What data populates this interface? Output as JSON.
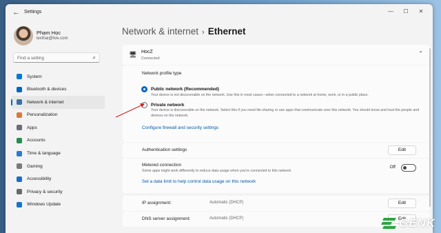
{
  "window": {
    "title": "Settings",
    "back_icon": "back-arrow-icon",
    "controls": [
      "—",
      "☐",
      "✕"
    ]
  },
  "user": {
    "name": "Phạm Học",
    "email": "lexthai@live.com"
  },
  "search": {
    "placeholder": "Find a setting"
  },
  "sidebar": {
    "items": [
      {
        "label": "System",
        "icon": "monitor-icon",
        "color": "#0078d4",
        "active": false
      },
      {
        "label": "Bluetooth & devices",
        "icon": "bluetooth-icon",
        "color": "#0067c0",
        "active": false
      },
      {
        "label": "Network & internet",
        "icon": "wifi-icon",
        "color": "#3b6ea8",
        "active": true
      },
      {
        "label": "Personalization",
        "icon": "brush-icon",
        "color": "#d97a3a",
        "active": false
      },
      {
        "label": "Apps",
        "icon": "apps-icon",
        "color": "#6b6b7a",
        "active": false
      },
      {
        "label": "Accounts",
        "icon": "person-icon",
        "color": "#2b8a4e",
        "active": false
      },
      {
        "label": "Time & language",
        "icon": "clock-globe-icon",
        "color": "#2b7bd0",
        "active": false
      },
      {
        "label": "Gaming",
        "icon": "controller-icon",
        "color": "#7a7a7a",
        "active": false
      },
      {
        "label": "Accessibility",
        "icon": "accessibility-icon",
        "color": "#1c6dc9",
        "active": false
      },
      {
        "label": "Privacy & security",
        "icon": "shield-icon",
        "color": "#6a6a6a",
        "active": false
      },
      {
        "label": "Windows Update",
        "icon": "update-icon",
        "color": "#1a73c6",
        "active": false
      }
    ]
  },
  "breadcrumb": {
    "parent": "Network & internet",
    "separator": "›",
    "current": "Ethernet"
  },
  "connection": {
    "name": "HocZ",
    "status": "Connected"
  },
  "profile": {
    "title": "Network profile type",
    "public_title": "Public network (Recommended)",
    "public_desc": "Your device is not discoverable on the network. Use this in most cases—when connected to a network at home, work, or in a public place.",
    "public_selected": true,
    "private_title": "Private network",
    "private_desc": "Your device is discoverable on the network. Select this if you need file sharing or use apps that communicate over this network. You should know and trust the people and devices on the network.",
    "private_selected": false,
    "firewall_link": "Configure firewall and security settings"
  },
  "auth": {
    "label": "Authentication settings",
    "button": "Edit"
  },
  "metered": {
    "title": "Metered connection",
    "desc": "Some apps might work differently to reduce data usage when you're connected to this network",
    "toggle_label": "Off",
    "toggle_on": false,
    "link": "Set a data limit to help control data usage on this network"
  },
  "ip": {
    "label": "IP assignment:",
    "value": "Automatic (DHCP)",
    "button": "Edit"
  },
  "dns": {
    "label": "DNS server assignment:",
    "value": "Automatic (DHCP)",
    "button": "Edit"
  },
  "watermark": {
    "text": "GENK",
    "color": "#2aa640"
  }
}
